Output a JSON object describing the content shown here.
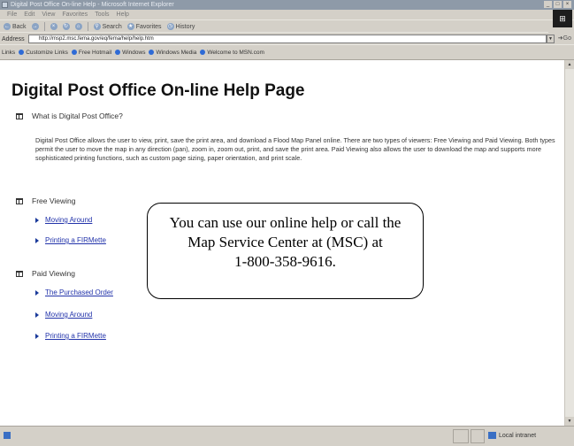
{
  "window": {
    "title": "Digital Post Office On-line Help - Microsoft Internet Explorer",
    "controls": [
      "_",
      "□",
      "×"
    ]
  },
  "menu": [
    "File",
    "Edit",
    "View",
    "Favorites",
    "Tools",
    "Help"
  ],
  "toolbar": {
    "back": "Back",
    "search": "Search",
    "favorites": "Favorites",
    "history": "History"
  },
  "address": {
    "label": "Address",
    "url": "http://msp2.msc.fema.gov/eq/fema/help/help.htm",
    "go": "Go"
  },
  "links": {
    "label": "Links",
    "items": [
      "Customize Links",
      "Free Hotmail",
      "Windows",
      "Windows Media",
      "Welcome to MSN.com"
    ]
  },
  "page": {
    "title": "Digital Post Office On-line Help Page",
    "sections": [
      {
        "heading": "What is Digital Post Office?",
        "description": "Digital Post Office allows the user to view, print, save the print area, and download a Flood Map Panel online. There are two types of viewers: Free Viewing and Paid Viewing. Both types permit the user to move the map in any direction (pan), zoom in, zoom out, print, and save the print area. Paid Viewing also allows the user to download the map and supports more sophisticated printing functions, such as custom page sizing, paper orientation, and print scale."
      },
      {
        "heading": "Free Viewing",
        "links": [
          "Moving Around",
          "Printing a FIRMette"
        ]
      },
      {
        "heading": "Paid Viewing",
        "links": [
          "The Purchased Order",
          "Moving Around",
          "Printing a FIRMette"
        ]
      }
    ]
  },
  "callout": {
    "lines": [
      "You can use our online help or call the",
      "Map Service Center at (MSC) at",
      "1-800-358-9616."
    ]
  },
  "status": {
    "zone": "Local intranet"
  }
}
